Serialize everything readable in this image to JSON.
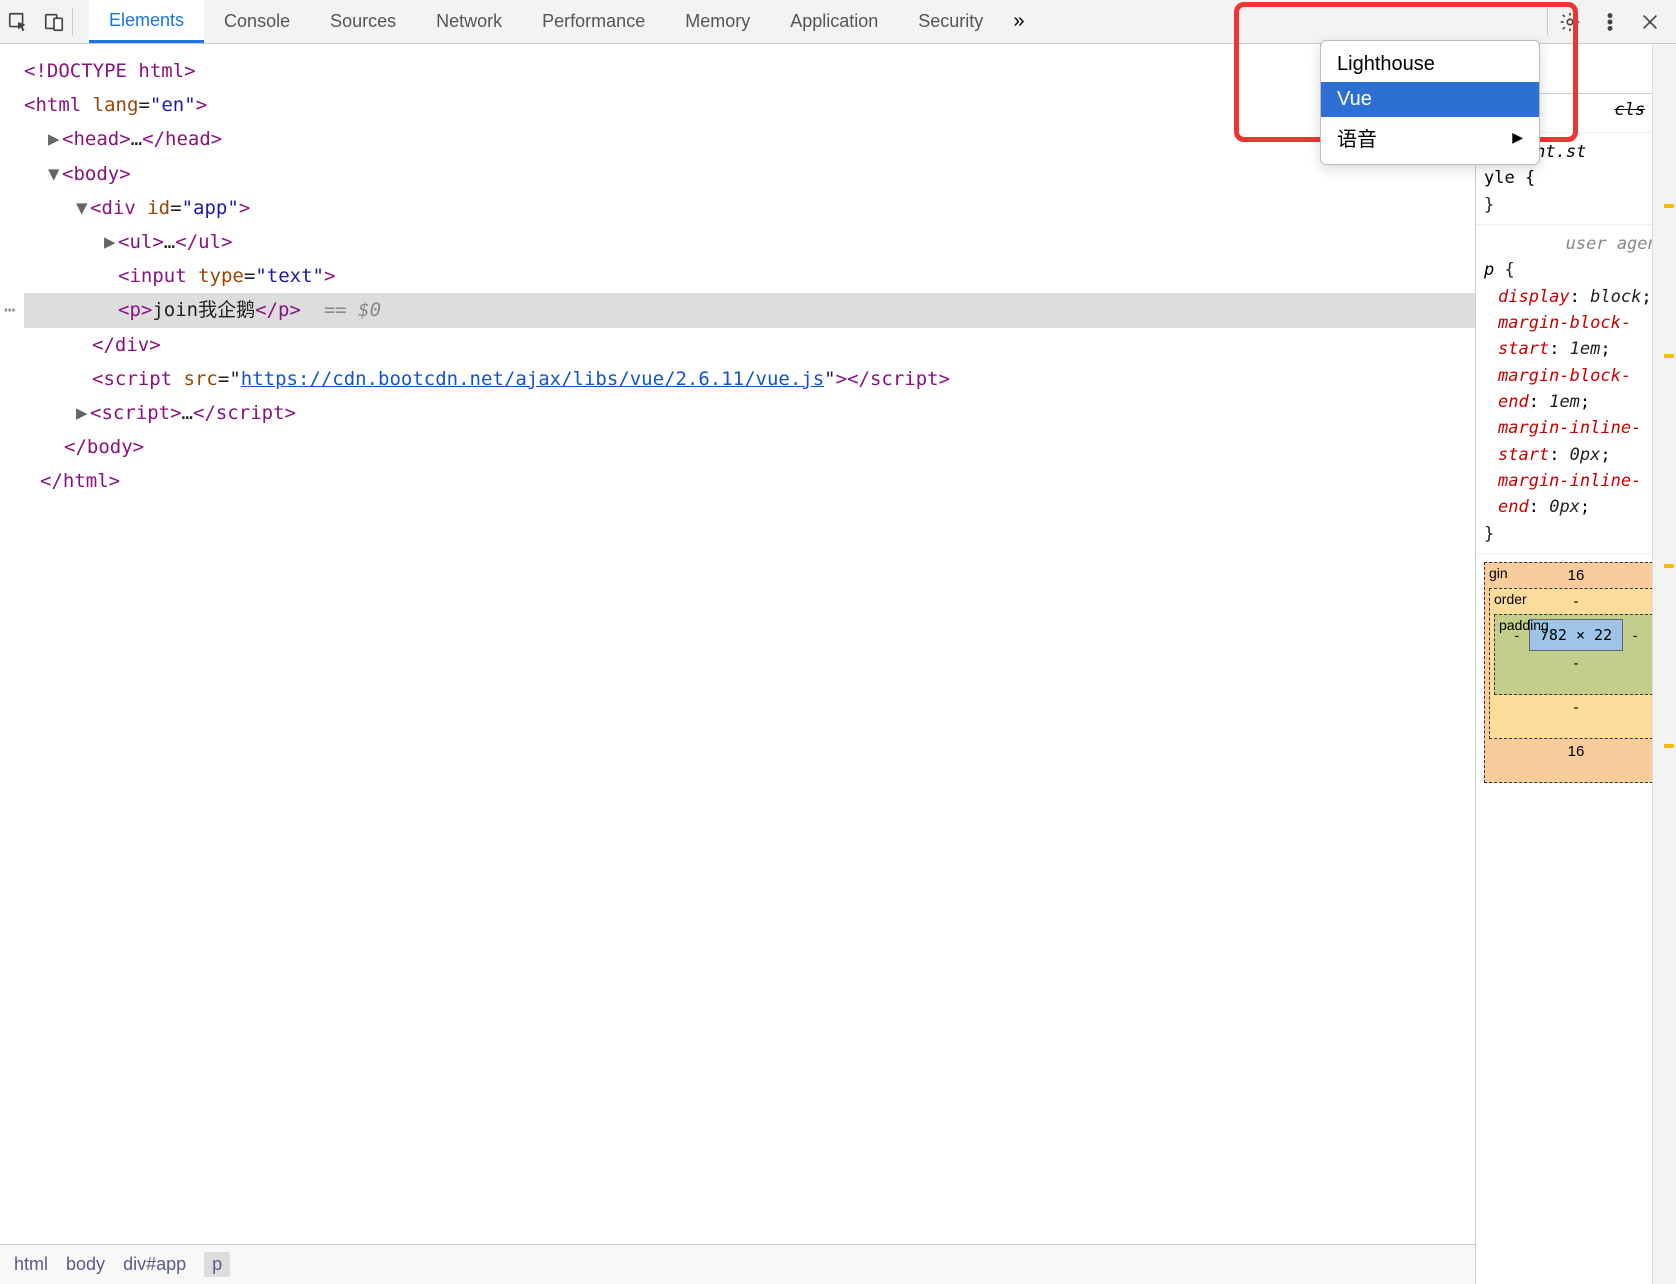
{
  "toolbar": {
    "tabs": [
      "Elements",
      "Console",
      "Sources",
      "Network",
      "Performance",
      "Memory",
      "Application",
      "Security"
    ],
    "active_tab": 0
  },
  "dropdown": {
    "items": [
      {
        "label": "Lighthouse",
        "submenu": false,
        "highlighted": false
      },
      {
        "label": "Vue",
        "submenu": false,
        "highlighted": true
      },
      {
        "label": "语音",
        "submenu": true,
        "highlighted": false
      }
    ]
  },
  "dom": {
    "doctype": "<!DOCTYPE html>",
    "html_open": {
      "tag": "html",
      "attr": "lang",
      "val": "en"
    },
    "head": {
      "tag": "head",
      "ellipsis": "…"
    },
    "body_open": {
      "tag": "body"
    },
    "div_open": {
      "tag": "div",
      "attr": "id",
      "val": "app"
    },
    "ul": {
      "tag": "ul",
      "ellipsis": "…"
    },
    "input": {
      "tag": "input",
      "attr": "type",
      "val": "text"
    },
    "p": {
      "tag": "p",
      "text": "join我企鹅",
      "hint": "== $0"
    },
    "div_close": {
      "tag": "div"
    },
    "script1": {
      "tag": "script",
      "attr": "src",
      "val": "https://cdn.bootcdn.net/ajax/libs/vue/2.6.11/vue.js"
    },
    "script2": {
      "tag": "script",
      "ellipsis": "…"
    },
    "body_close": {
      "tag": "body"
    },
    "html_close": {
      "tag": "html"
    }
  },
  "breadcrumbs": [
    "html",
    "body",
    "div#app",
    "p"
  ],
  "styles": {
    "header": {
      "cls": "cls",
      "plus": "+"
    },
    "element_style": {
      "selector": "element.st",
      "props_partial": "yle {"
    },
    "ua_label": "user agen…",
    "rule": {
      "selector": "p",
      "props": [
        {
          "n": "display",
          "v": "block"
        },
        {
          "n": "margin-block-start",
          "v": "1em"
        },
        {
          "n": "margin-block-end",
          "v": "1em"
        },
        {
          "n": "margin-inline-start",
          "v": "0px"
        },
        {
          "n": "margin-inline-end",
          "v": "0px"
        }
      ]
    }
  },
  "box_model": {
    "margin": {
      "label": "gin",
      "top": "16",
      "right": "",
      "bottom": "16",
      "left": ""
    },
    "border": {
      "label": "order",
      "val": "-"
    },
    "padding": {
      "label": "padding",
      "val": "-"
    },
    "content": "782 × 22"
  }
}
